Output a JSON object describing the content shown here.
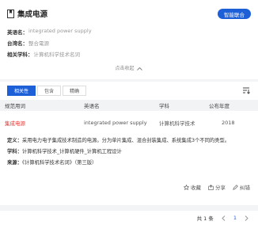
{
  "term": {
    "title": "集成电源",
    "smart_button": "智能联合"
  },
  "info": {
    "english_label": "英语名：",
    "english_value": "integrated power supply",
    "taiwan_label": "台湾名：",
    "taiwan_value": "整合電源",
    "discipline_label": "相关学科：",
    "discipline_value": "计算机科学技术名词",
    "collapse": "点击收起"
  },
  "tabs": [
    "相关性",
    "包含",
    "精确"
  ],
  "table": {
    "headers": [
      "规范用词",
      "英语名",
      "学科",
      "公布年度"
    ],
    "row": [
      "集成电源",
      "integrated power supply",
      "计算机科学技术",
      "2018"
    ]
  },
  "detail": {
    "definition_label": "定义：",
    "definition": "采用电力电子集成技术制造的电源。分为单片集成、混合封装集成、系统集成3个不同的类型。",
    "discipline_label": "学科：",
    "discipline": "计算机科学技术_计算机硬件_计算机工程设计",
    "source_label": "来源：",
    "source": "《计算机科学技术名词》（第三版）"
  },
  "actions": {
    "favorite": "收藏",
    "share": "分享",
    "correct": "纠错"
  },
  "pager": {
    "total": "共 1 条",
    "page": "1"
  }
}
